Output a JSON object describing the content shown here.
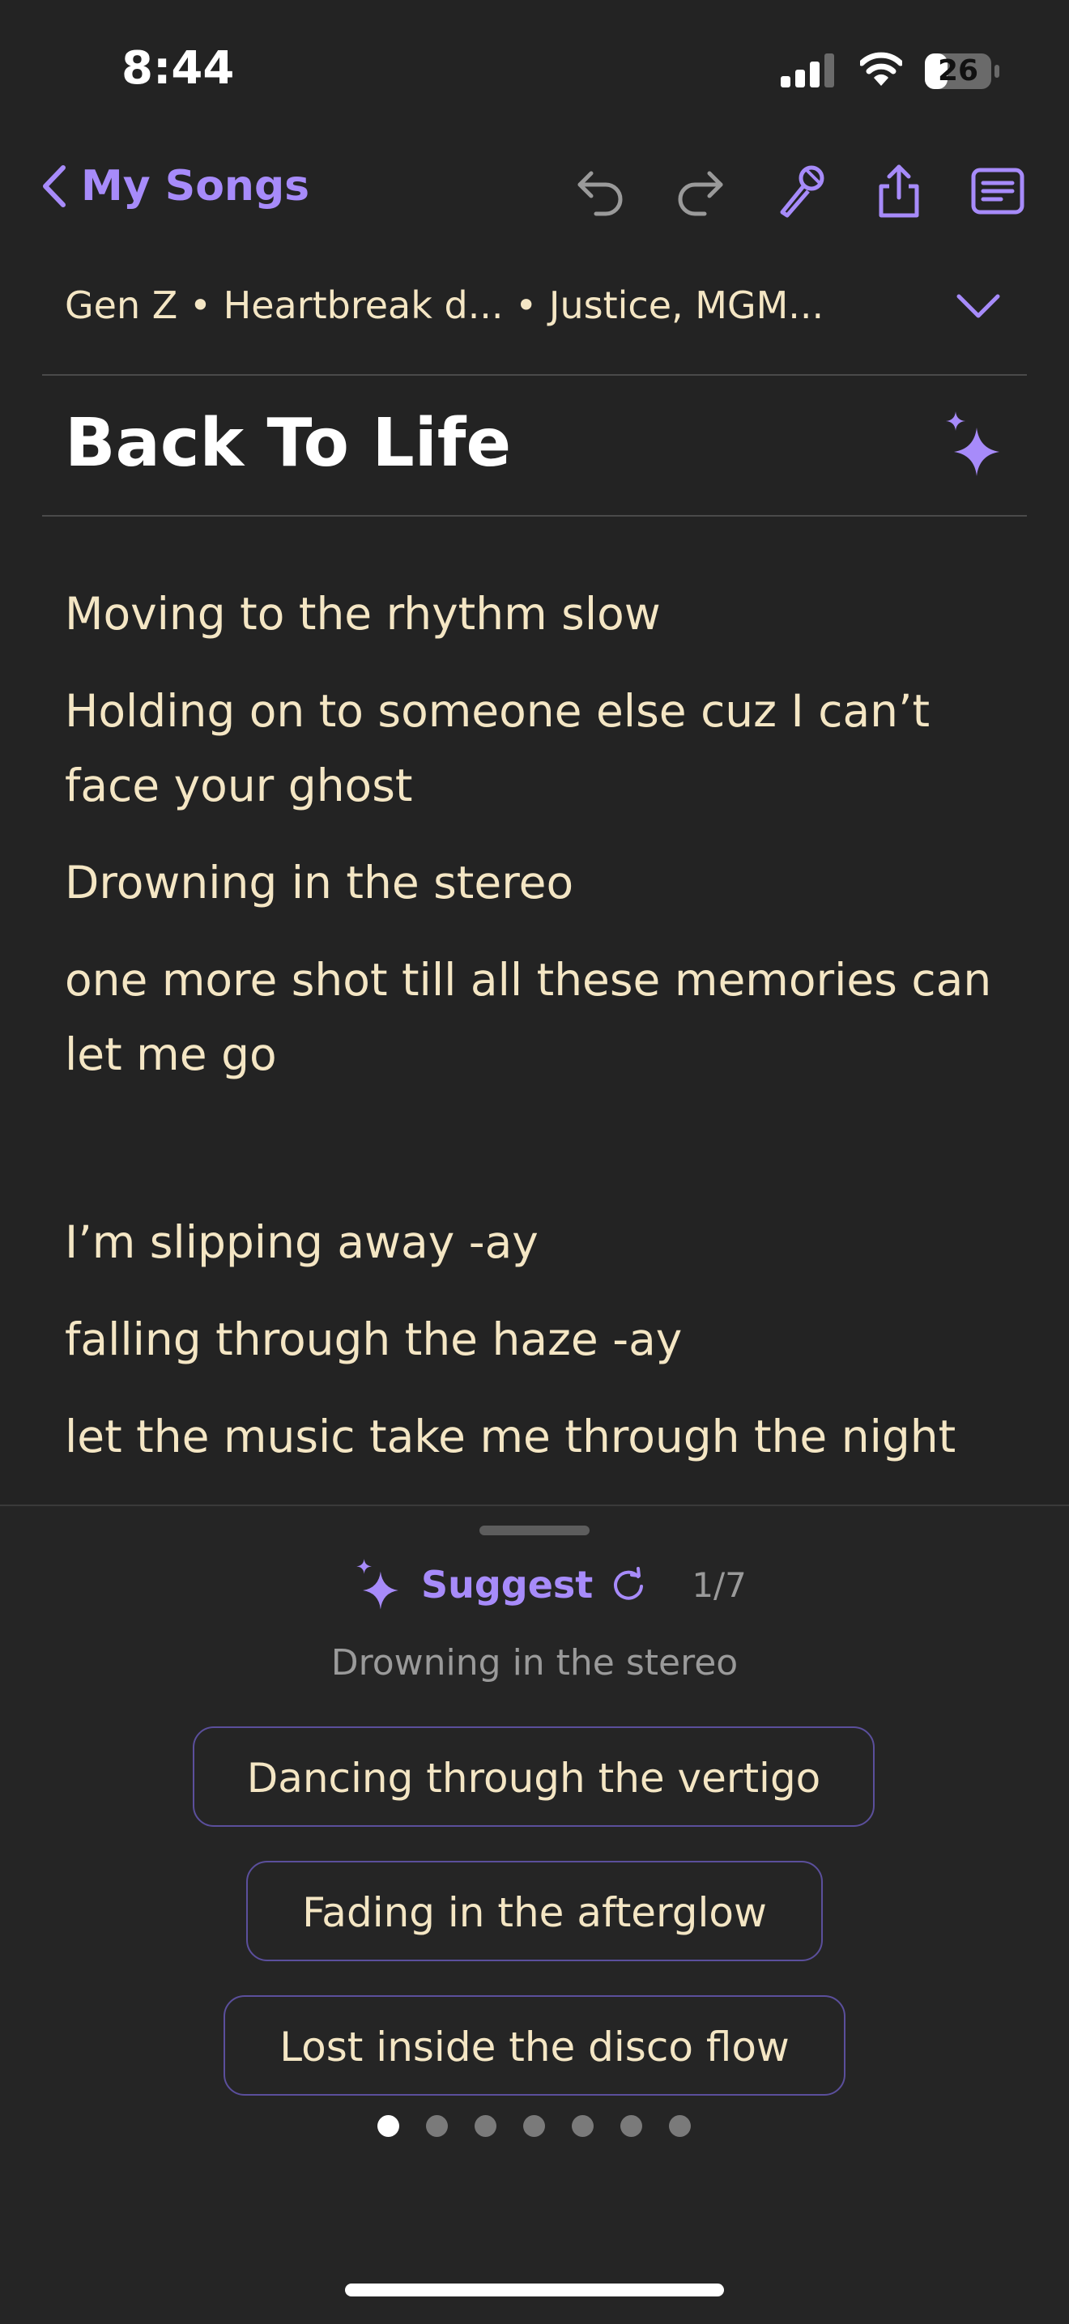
{
  "status_bar": {
    "time": "8:44",
    "battery": "26"
  },
  "nav": {
    "back_label": "My Songs"
  },
  "song": {
    "meta": "Gen Z • Heartbreak d... • Justice, MGM...",
    "title": "Back To Life"
  },
  "lyrics": [
    "Moving to the rhythm slow",
    "Holding on to someone else cuz I can’t face your ghost",
    "Drowning in the stereo",
    "one more shot till all these memories can let me go",
    "",
    "I’m slipping away -ay",
    "falling through the haze -ay",
    "let the music take me through the night"
  ],
  "suggest": {
    "label": "Suggest",
    "page": "1/7",
    "target_line": "Drowning in the stereo",
    "options": [
      "Dancing through the vertigo",
      "Fading in the afterglow",
      "Lost inside the disco flow"
    ],
    "page_total": 7,
    "page_active": 1
  },
  "colors": {
    "accent": "#a78bfa",
    "lyric_text": "#f4e6c4",
    "background": "#232323"
  }
}
